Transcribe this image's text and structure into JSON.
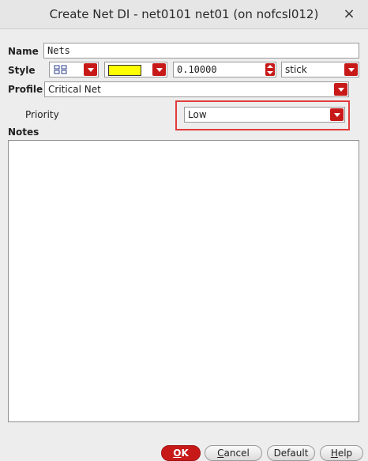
{
  "window": {
    "title": "Create Net DI - net0101 net01 (on nofcsl012)",
    "close_glyph": "×"
  },
  "form": {
    "name_label": "Name",
    "name_value": "Nets",
    "style_label": "Style",
    "style_pattern_icon": "line-pattern-icon",
    "style_color": "#ffff00",
    "style_width_value": "0.10000",
    "style_type_value": "stick",
    "profile_label": "Profile",
    "profile_value": "Critical Net",
    "priority_label": "Priority",
    "priority_value": "Low",
    "notes_label": "Notes"
  },
  "buttons": {
    "ok": {
      "first": "O",
      "rest": "K"
    },
    "cancel": {
      "first": "C",
      "rest": "ancel"
    },
    "default": "Default",
    "help": {
      "first": "H",
      "rest": "elp"
    }
  },
  "colors": {
    "accent": "#c81919",
    "highlight": "#e23b3b"
  }
}
